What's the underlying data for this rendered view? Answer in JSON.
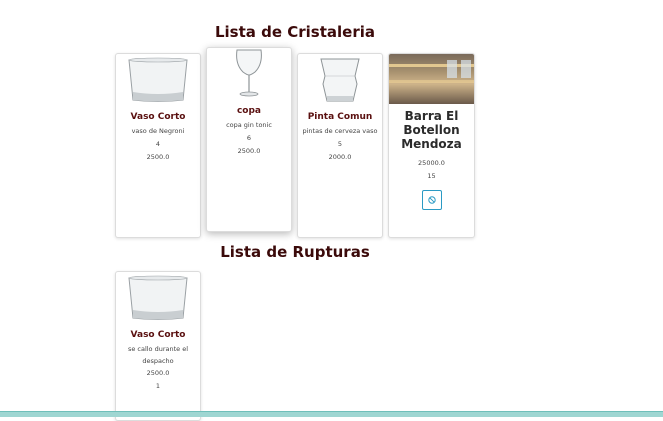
{
  "sections": {
    "cristaleria_title": "Lista de Cristaleria",
    "rupturas_title": "Lista de Rupturas"
  },
  "cristaleria": [
    {
      "name": "Vaso Corto",
      "description": "vaso de Negroni",
      "quantity": "4",
      "price": "2500.0",
      "icon": "short-glass-icon"
    },
    {
      "name": "copa",
      "description": "copa gin tonic",
      "quantity": "6",
      "price": "2500.0",
      "icon": "wine-glass-icon"
    },
    {
      "name": "Pinta Comun",
      "description": "pintas de cerveza vaso",
      "quantity": "5",
      "price": "2000.0",
      "icon": "pint-glass-icon"
    },
    {
      "name": "Barra El Botellon Mendoza",
      "price": "25000.0",
      "quantity": "15",
      "icon": "bar-photo",
      "action_icon": "ban-icon"
    }
  ],
  "rupturas": [
    {
      "name": "Vaso Corto",
      "description": "se callo durante el despacho",
      "price": "2500.0",
      "quantity": "1",
      "icon": "short-glass-icon"
    }
  ],
  "colors": {
    "title": "#3b0a0a",
    "card_title": "#5a1010",
    "accent": "#2a9ac4",
    "bottom_bar": "#9fd6d2"
  }
}
